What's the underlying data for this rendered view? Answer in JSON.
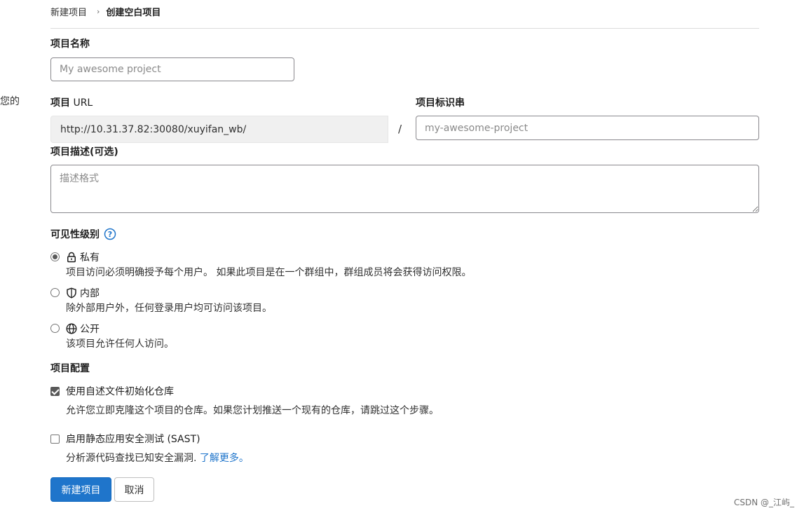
{
  "left_cut_text": "您的",
  "breadcrumb": {
    "parent": "新建项目",
    "separator": "›",
    "current": "创建空白项目"
  },
  "project_name": {
    "label": "项目名称",
    "placeholder": "My awesome project",
    "value": ""
  },
  "project_url": {
    "label_bold": "项目",
    "label_normal": " URL",
    "prefix": "http://10.31.37.82:30080/xuyifan_wb/",
    "slash": "/"
  },
  "project_slug": {
    "label": "项目标识串",
    "placeholder": "my-awesome-project"
  },
  "description": {
    "label": "项目描述(可选)",
    "placeholder": "描述格式"
  },
  "visibility": {
    "title": "可见性级别",
    "help_icon": "question-circle-icon",
    "options": [
      {
        "icon": "lock-icon",
        "label": "私有",
        "help": "项目访问必须明确授予每个用户。 如果此项目是在一个群组中，群组成员将会获得访问权限。",
        "checked": true
      },
      {
        "icon": "shield-icon",
        "label": "内部",
        "help": "除外部用户外，任何登录用户均可访问该项目。",
        "checked": false
      },
      {
        "icon": "globe-icon",
        "label": "公开",
        "help": "该项目允许任何人访问。",
        "checked": false
      }
    ]
  },
  "config": {
    "title": "项目配置",
    "readme": {
      "label": "使用自述文件初始化仓库",
      "help": "允许您立即克隆这个项目的仓库。如果您计划推送一个现有的仓库，请跳过这个步骤。",
      "checked": true
    },
    "sast": {
      "label": "启用静态应用安全测试 (SAST)",
      "help": "分析源代码查找已知安全漏洞. ",
      "link": "了解更多。",
      "checked": false
    }
  },
  "buttons": {
    "create": "新建项目",
    "cancel": "取消"
  },
  "watermark": "CSDN @_江屿_",
  "colors": {
    "primary": "#1f75cb",
    "link": "#1f75cb"
  }
}
